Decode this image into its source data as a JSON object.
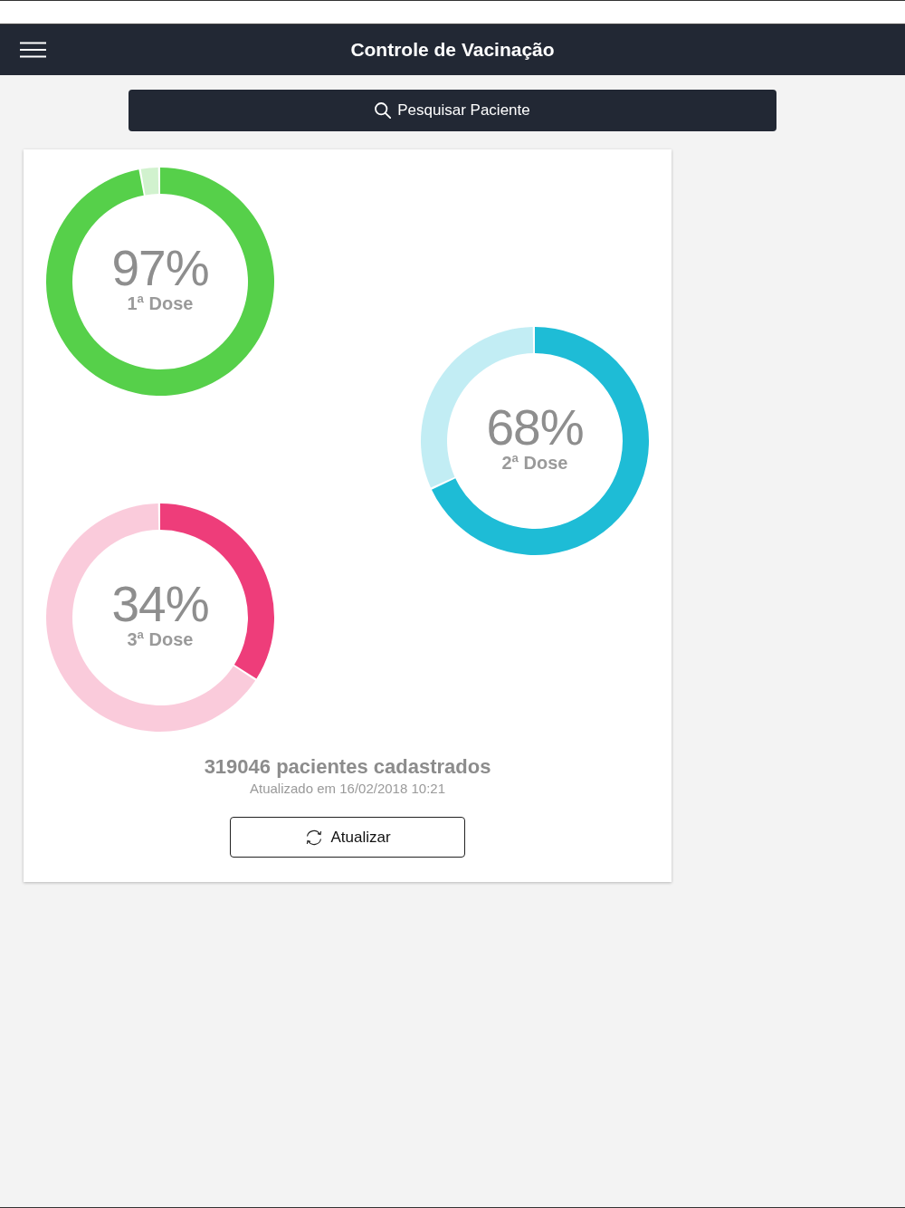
{
  "header": {
    "title": "Controle de Vacinação"
  },
  "search_button": {
    "label": "Pesquisar Paciente"
  },
  "doses": [
    {
      "percent": "97%",
      "color": "#56d04a",
      "chart_data": {
        "type": "donut",
        "title": "1ª Dose",
        "values": [
          97,
          3
        ]
      }
    },
    {
      "percent": "68%",
      "color": "#1ebcd6",
      "chart_data": {
        "type": "donut",
        "title": "2ª Dose",
        "values": [
          68,
          32
        ]
      }
    },
    {
      "percent": "34%",
      "color": "#ee3d7a",
      "chart_data": {
        "type": "donut",
        "title": "3ª Dose",
        "values": [
          34,
          66
        ]
      }
    }
  ],
  "summary": {
    "patients": "319046 pacientes cadastrados",
    "updated": "Atualizado em 16/02/2018 10:21"
  },
  "refresh_button": {
    "label": "Atualizar"
  }
}
